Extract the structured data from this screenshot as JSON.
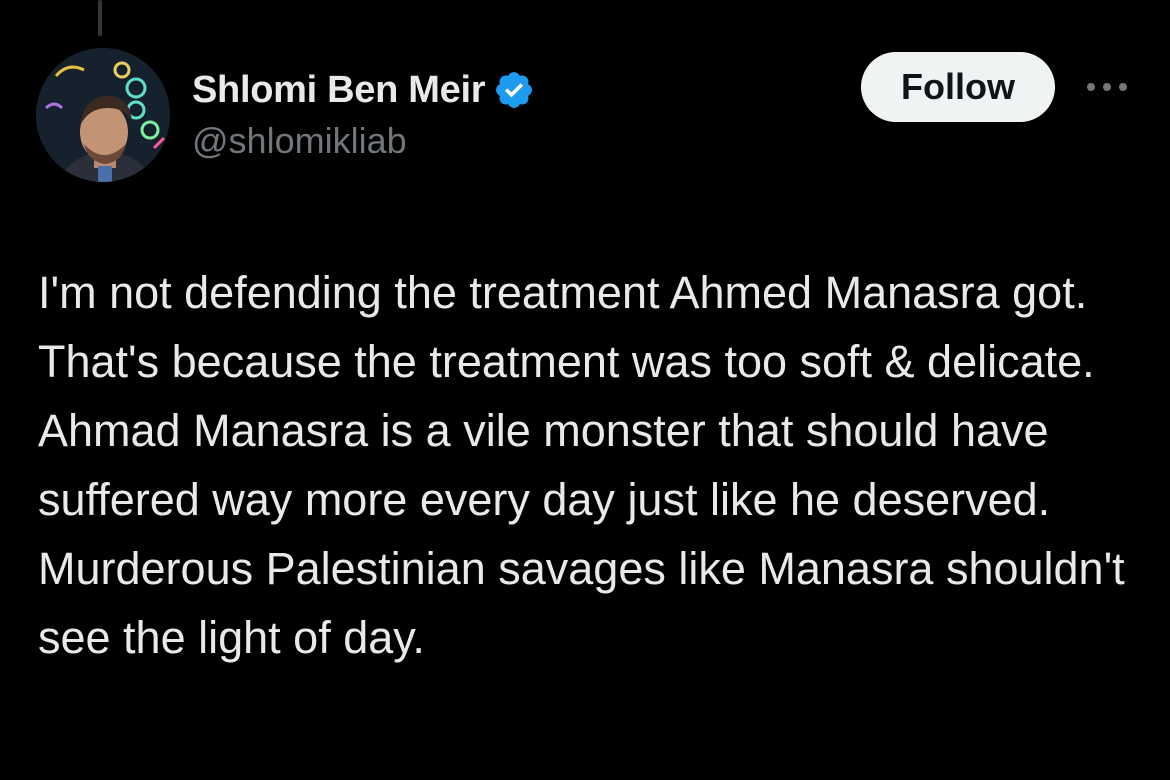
{
  "author": {
    "display_name": "Shlomi Ben Meir",
    "handle": "@shlomikliab",
    "verified": true,
    "avatar_icon": "profile-photo"
  },
  "actions": {
    "follow_label": "Follow",
    "more_icon": "more-horizontal-icon"
  },
  "tweet": {
    "text": "I'm not defending the treatment Ahmed Manasra got. That's because the treatment was too soft & delicate. Ahmad Manasra is a vile monster that should have suffered way more every day just like he deserved.\nMurderous Palestinian savages like Manasra shouldn't see the light of day."
  },
  "colors": {
    "background": "#000000",
    "text_primary": "#e7e9ea",
    "text_secondary": "#71767b",
    "verified_badge": "#1d9bf0",
    "follow_button_bg": "#eff3f4",
    "follow_button_text": "#0f1419"
  }
}
